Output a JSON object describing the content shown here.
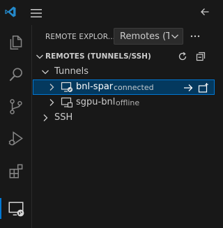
{
  "topbar": {
    "logo_icon": "vscode-logo-icon",
    "menu_icon": "menu-icon",
    "back_icon": "arrow-left-icon"
  },
  "activity_bar": {
    "items": [
      {
        "name": "explorer",
        "icon": "files-icon"
      },
      {
        "name": "search",
        "icon": "search-icon"
      },
      {
        "name": "source-control",
        "icon": "source-control-icon"
      },
      {
        "name": "run-and-debug",
        "icon": "run-debug-icon"
      },
      {
        "name": "extensions",
        "icon": "extensions-icon"
      },
      {
        "name": "remote-explorer",
        "icon": "remote-explorer-icon",
        "active": true
      }
    ]
  },
  "sidebar": {
    "view_title": "REMOTE EXPLOR...",
    "remote_select": {
      "value": "Remotes (T"
    },
    "more_actions_icon": "ellipsis-icon",
    "section": {
      "label": "REMOTES (TUNNELS/SSH)",
      "expanded": true,
      "refresh_icon": "refresh-icon",
      "collapse_icon": "collapse-all-icon"
    },
    "tree": {
      "tunnels_label": "Tunnels",
      "tunnels": [
        {
          "name": "bnl-spar",
          "status": "connected",
          "selected": true,
          "actions": [
            "arrow-right-icon",
            "new-window-icon"
          ]
        },
        {
          "name": "sgpu-bnl",
          "status": "offline",
          "selected": false
        }
      ],
      "ssh_label": "SSH"
    }
  },
  "colors": {
    "background": "#181818",
    "selection_bg": "#04395e",
    "focus_border": "#0078d4",
    "vscode_blue": "#2489ca"
  }
}
